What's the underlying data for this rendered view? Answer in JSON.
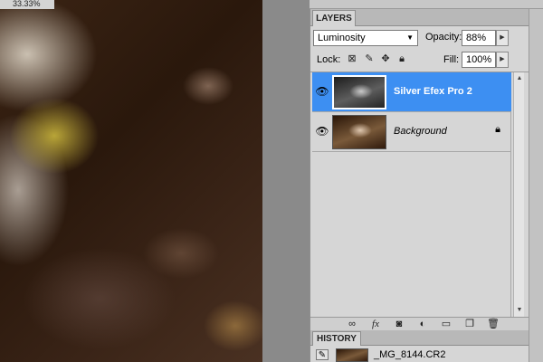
{
  "document": {
    "zoom": "33.33%"
  },
  "layers_panel": {
    "tab_label": "LAYERS",
    "blend_mode": "Luminosity",
    "opacity_label": "Opacity:",
    "opacity_value": "88%",
    "lock_label": "Lock:",
    "fill_label": "Fill:",
    "fill_value": "100%",
    "layers": [
      {
        "name": "Silver Efex Pro 2",
        "visible": true,
        "selected": true
      },
      {
        "name": "Background",
        "visible": true,
        "selected": false,
        "locked": true
      }
    ]
  },
  "history_panel": {
    "tab_label": "HISTORY",
    "items": [
      {
        "label": "_MG_8144.CR2"
      }
    ]
  },
  "colors": {
    "selection": "#3d8ff2",
    "panel_bg": "#d6d6d6"
  },
  "icons": {
    "eye": "eye-icon",
    "lock_transparent": "lock-transparent-icon",
    "lock_pixels": "brush-icon",
    "lock_position": "move-icon",
    "lock_all": "lock-icon",
    "link": "link-icon",
    "fx": "fx-icon",
    "mask": "mask-icon",
    "adjustment": "adjustment-icon",
    "group": "folder-icon",
    "new_layer": "new-layer-icon",
    "delete": "trash-icon"
  }
}
